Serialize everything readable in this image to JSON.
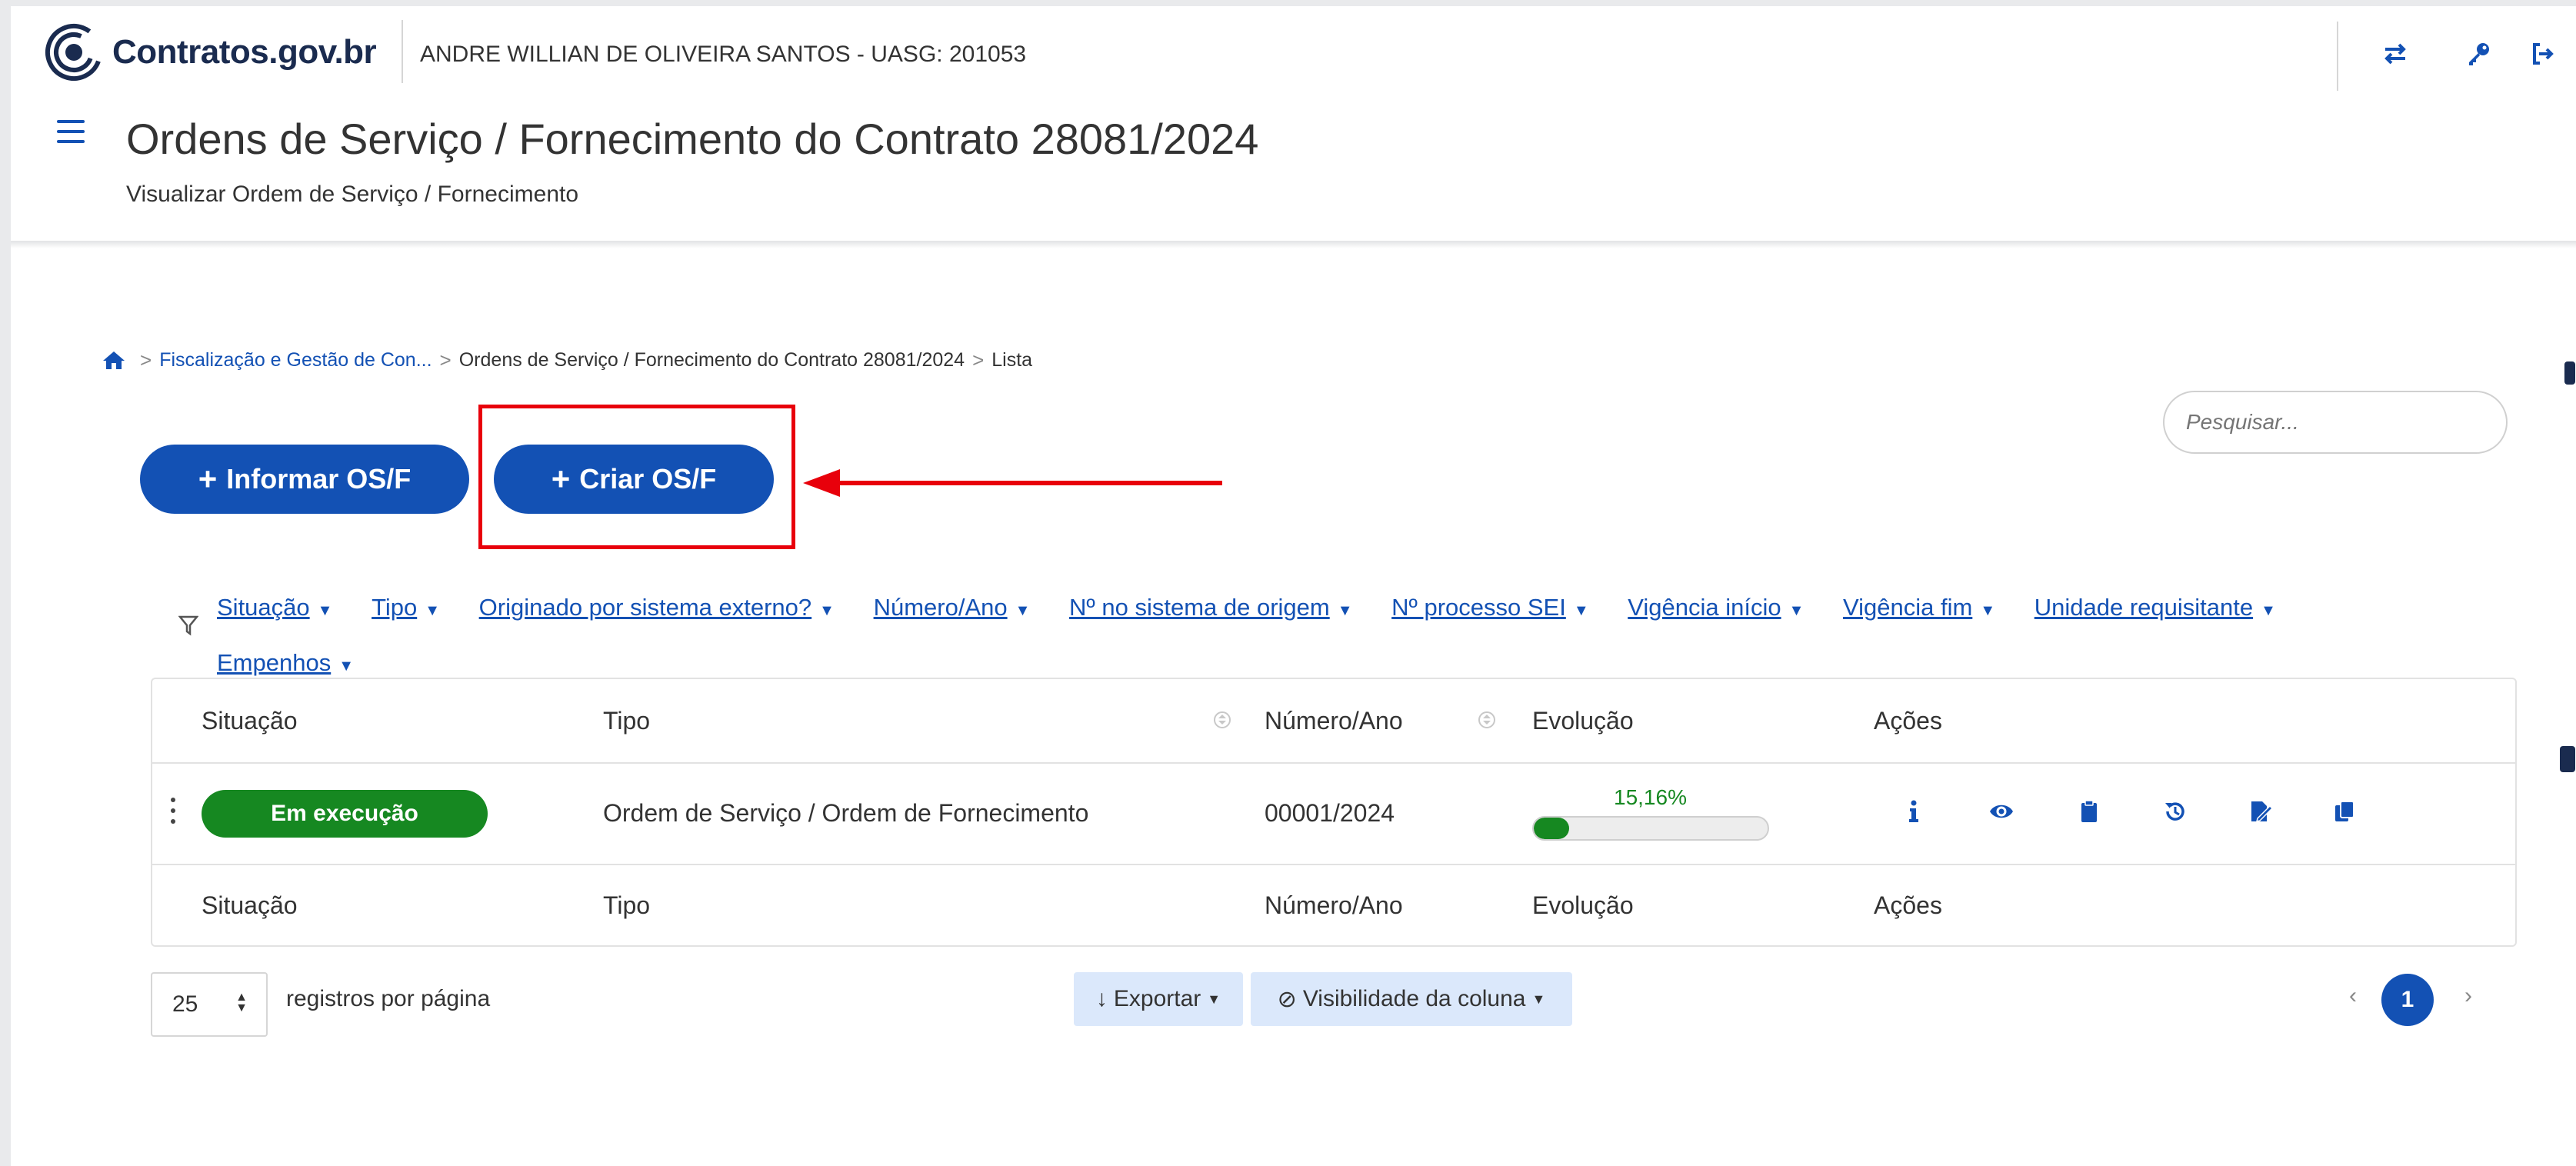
{
  "header": {
    "logo_text": "Contratos.gov.br",
    "user_info": "ANDRE WILLIAN DE OLIVEIRA SANTOS - UASG: 201053",
    "icons": [
      "swap-arrows-icon",
      "key-icon",
      "logout-icon"
    ]
  },
  "page": {
    "title": "Ordens de Serviço / Fornecimento do Contrato 28081/2024",
    "subtitle": "Visualizar Ordem de Serviço / Fornecimento"
  },
  "breadcrumb": {
    "items": [
      "Fiscalização e Gestão de Con...",
      "Ordens de Serviço / Fornecimento do Contrato 28081/2024",
      "Lista"
    ],
    "sep": ">"
  },
  "search": {
    "placeholder": "Pesquisar..."
  },
  "buttons": {
    "informar": "Informar OS/F",
    "criar": "Criar OS/F",
    "plus": "+"
  },
  "filters": [
    "Situação",
    "Tipo",
    "Originado por sistema externo?",
    "Número/Ano",
    "Nº no sistema de origem",
    "Nº processo SEI",
    "Vigência início",
    "Vigência fim",
    "Unidade requisitante",
    "Empenhos"
  ],
  "table": {
    "headers": [
      "Situação",
      "Tipo",
      "Número/Ano",
      "Evolução",
      "Ações"
    ],
    "rows": [
      {
        "situacao": "Em execução",
        "tipo": "Ordem de Serviço / Ordem de Fornecimento",
        "numero": "00001/2024",
        "evolucao_label": "15,16%",
        "evolucao_value": 15.16
      }
    ]
  },
  "footer": {
    "per_page_value": "25",
    "per_page_label": "registros por página",
    "export_label": "Exportar",
    "visibility_label": "Visibilidade da coluna",
    "current_page": "1",
    "prev": "‹",
    "next": "›",
    "export_icon": "↓",
    "visibility_icon": "⊘"
  },
  "colors": {
    "primary": "#1351b4",
    "success": "#168821",
    "highlight": "#e8000b"
  }
}
